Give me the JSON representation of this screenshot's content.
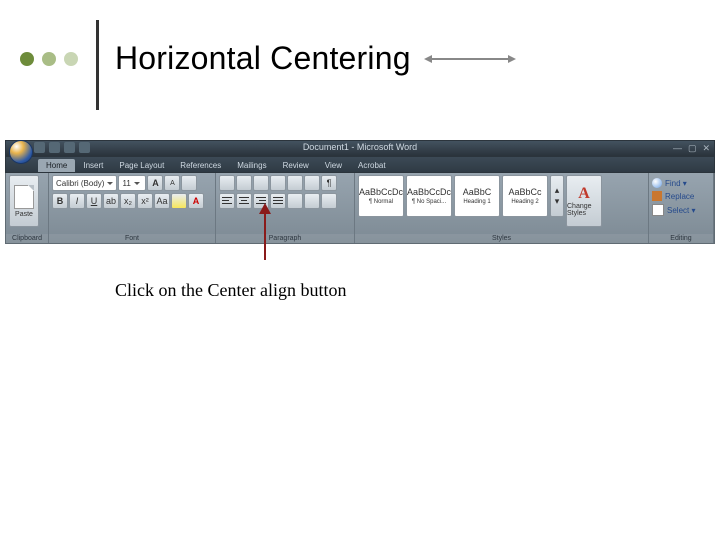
{
  "slide": {
    "title": "Horizontal Centering",
    "dot_colors": [
      "#6e8c3b",
      "#a9bd86",
      "#c9d6b4"
    ]
  },
  "instruction": "Click on the Center align button",
  "word": {
    "title": "Document1 - Microsoft Word",
    "tabs": [
      "Home",
      "Insert",
      "Page Layout",
      "References",
      "Mailings",
      "Review",
      "View",
      "Acrobat"
    ],
    "active_tab": 0,
    "groups": {
      "clipboard": {
        "label": "Clipboard",
        "paste": "Paste"
      },
      "font": {
        "label": "Font",
        "family": "Calibri (Body)",
        "size": "11"
      },
      "paragraph": {
        "label": "Paragraph"
      },
      "styles": {
        "label": "Styles",
        "change": "Change Styles",
        "items": [
          {
            "sample": "AaBbCcDc",
            "name": "¶ Normal"
          },
          {
            "sample": "AaBbCcDc",
            "name": "¶ No Spaci..."
          },
          {
            "sample": "AaBbC",
            "name": "Heading 1"
          },
          {
            "sample": "AaBbCc",
            "name": "Heading 2"
          }
        ]
      },
      "editing": {
        "label": "Editing",
        "find": "Find ▾",
        "replace": "Replace",
        "select": "Select ▾"
      }
    }
  }
}
